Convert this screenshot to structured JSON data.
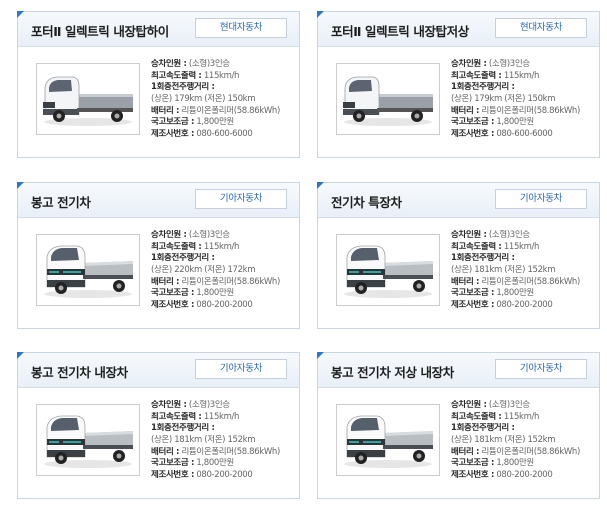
{
  "cards": [
    {
      "title": "포터Ⅱ 일렉트릭 내장탑하이",
      "maker": "현대자동차",
      "truck": "porter",
      "specs": {
        "capacity_label": "승차인원 :",
        "capacity": "(소형)3인승",
        "speed_label": "최고속도출력 :",
        "speed": "115km/h",
        "range_label": "1회충전주행거리 :",
        "range": "(상온) 179km (저온) 150km",
        "battery_label": "배터리 :",
        "battery": "리튬이온폴리머(58.86kWh)",
        "subsidy_label": "국고보조금 :",
        "subsidy": "1,800만원",
        "phone_label": "제조사번호 :",
        "phone": "080-600-6000"
      }
    },
    {
      "title": "포터Ⅱ 일렉트릭 내장탑저상",
      "maker": "현대자동차",
      "truck": "porter",
      "specs": {
        "capacity_label": "승차인원 :",
        "capacity": "(소형)3인승",
        "speed_label": "최고속도출력 :",
        "speed": "115km/h",
        "range_label": "1회충전주행거리 :",
        "range": "(상온) 179km (저온) 150km",
        "battery_label": "배터리 :",
        "battery": "리튬이온폴리머(58.86kWh)",
        "subsidy_label": "국고보조금 :",
        "subsidy": "1,800만원",
        "phone_label": "제조사번호 :",
        "phone": "080-600-6000"
      }
    },
    {
      "title": "봉고 전기차",
      "maker": "기아자동차",
      "truck": "bongo",
      "specs": {
        "capacity_label": "승차인원 :",
        "capacity": "(소형)3인승",
        "speed_label": "최고속도출력 :",
        "speed": "115km/h",
        "range_label": "1회충전주행거리 :",
        "range": "(상온) 220km (저온) 172km",
        "battery_label": "배터리 :",
        "battery": "리튬이온폴리머(58.86kWh)",
        "subsidy_label": "국고보조금 :",
        "subsidy": "1,800만원",
        "phone_label": "제조사번호 :",
        "phone": "080-200-2000"
      }
    },
    {
      "title": "전기차 특장차",
      "maker": "기아자동차",
      "truck": "bongo",
      "specs": {
        "capacity_label": "승차인원 :",
        "capacity": "(소형)3인승",
        "speed_label": "최고속도출력 :",
        "speed": "115km/h",
        "range_label": "1회충전주행거리 :",
        "range": "(상온) 181km (저온) 152km",
        "battery_label": "배터리 :",
        "battery": "리튬이온폴리머(58.86kWh)",
        "subsidy_label": "국고보조금 :",
        "subsidy": "1,800만원",
        "phone_label": "제조사번호 :",
        "phone": "080-200-2000"
      }
    },
    {
      "title": "봉고 전기차 내장차",
      "maker": "기아자동차",
      "truck": "bongo",
      "specs": {
        "capacity_label": "승차인원 :",
        "capacity": "(소형)3인승",
        "speed_label": "최고속도출력 :",
        "speed": "115km/h",
        "range_label": "1회충전주행거리 :",
        "range": "(상온) 181km (저온) 152km",
        "battery_label": "배터리 :",
        "battery": "리튬이온폴리머(58.86kWh)",
        "subsidy_label": "국고보조금 :",
        "subsidy": "1,800만원",
        "phone_label": "제조사번호 :",
        "phone": "080-200-2000"
      }
    },
    {
      "title": "봉고 전기차 저상 내장차",
      "maker": "기아자동차",
      "truck": "bongo",
      "specs": {
        "capacity_label": "승차인원 :",
        "capacity": "(소형)3인승",
        "speed_label": "최고속도출력 :",
        "speed": "115km/h",
        "range_label": "1회충전주행거리 :",
        "range": "(상온) 181km (저온) 152km",
        "battery_label": "배터리 :",
        "battery": "리튬이온폴리머(58.86kWh)",
        "subsidy_label": "국고보조금 :",
        "subsidy": "1,800만원",
        "phone_label": "제조사번호 :",
        "phone": "080-200-2000"
      }
    }
  ],
  "colors": {
    "accent": "#2d78c4",
    "maker_text": "#2a68b6",
    "border": "#c9d6e4"
  },
  "icons": {
    "vehicle_image": "truck-photo"
  }
}
